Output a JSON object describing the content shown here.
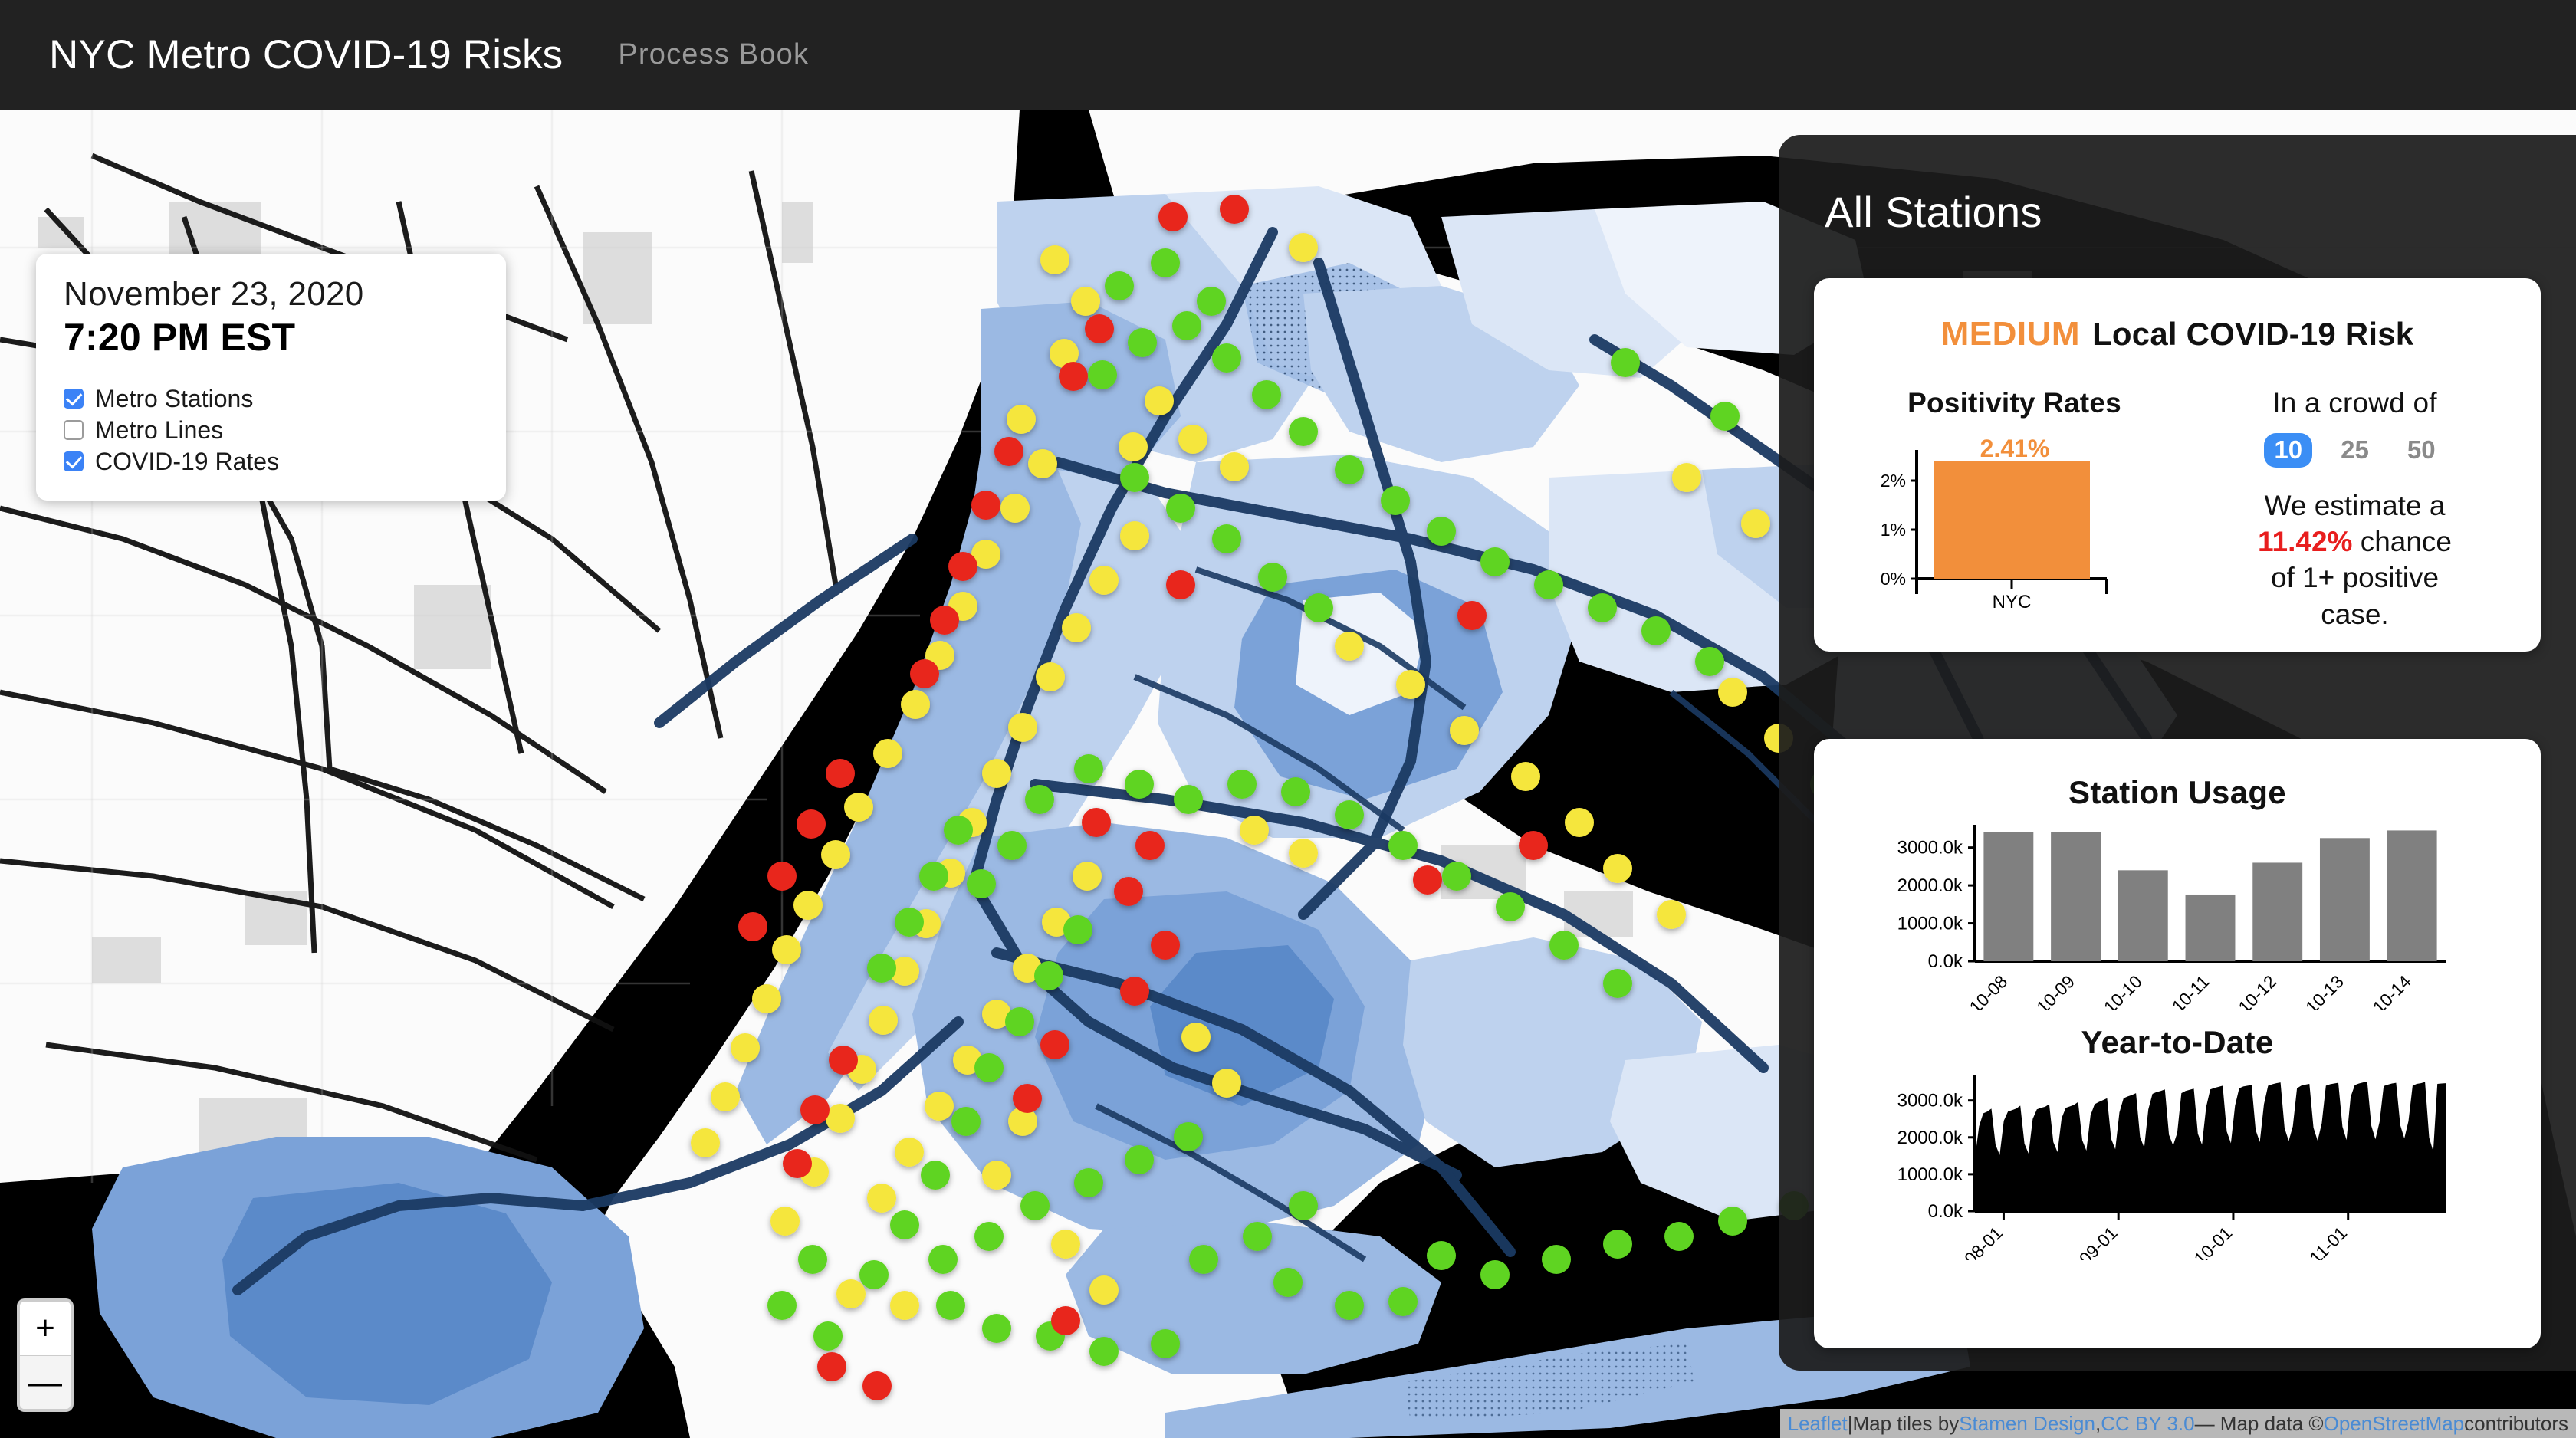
{
  "header": {
    "app_title": "NYC Metro COVID-19 Risks",
    "nav_link": "Process Book"
  },
  "legend": {
    "date": "November 23, 2020",
    "time": "7:20 PM EST",
    "layers": [
      {
        "label": "Metro Stations",
        "checked": true
      },
      {
        "label": "Metro Lines",
        "checked": false
      },
      {
        "label": "COVID-19 Rates",
        "checked": true
      }
    ]
  },
  "map": {
    "zoom_in_label": "+",
    "zoom_out_label": "—",
    "station_colors": {
      "low": "#5ed420",
      "medium": "#f5e63d",
      "high": "#e8251f"
    },
    "choropleth_colors": [
      "#eef3fb",
      "#dbe6f6",
      "#bed2ee",
      "#9bb9e3",
      "#7ba2d8",
      "#5b8ac9"
    ],
    "water_color": "#000000",
    "metro_line_color": "#1b3a63"
  },
  "attribution": {
    "leaflet": "Leaflet",
    "sep1": " | ",
    "tiles_by": "Map tiles by ",
    "stamen": "Stamen Design",
    "comma": ", ",
    "license": "CC BY 3.0",
    "dash": " — Map data © ",
    "osm": "OpenStreetMap",
    "contributors": " contributors"
  },
  "sidebar": {
    "title": "All Stations",
    "risk_card": {
      "risk_level": "MEDIUM",
      "risk_level_color": "#F28F3B",
      "risk_heading": "Local COVID-19 Risk",
      "positivity_heading": "Positivity Rates",
      "crowd_heading": "In a crowd of",
      "crowd_options": [
        {
          "label": "10",
          "active": true
        },
        {
          "label": "25",
          "active": false
        },
        {
          "label": "50",
          "active": false
        }
      ],
      "estimate_prefix": "We estimate a",
      "estimate_value": "11.42%",
      "estimate_value_color": "#E81E1E",
      "estimate_suffix_line1": "chance",
      "estimate_suffix_line2": "of 1+ positive",
      "estimate_suffix_line3": "case."
    }
  },
  "chart_data": [
    {
      "type": "bar",
      "id": "positivity-rates",
      "title": "Positivity Rates",
      "categories": [
        "NYC"
      ],
      "values": [
        2.41
      ],
      "value_labels": [
        "2.41%"
      ],
      "ytick_labels": [
        "0%",
        "1%",
        "2%"
      ],
      "yticks": [
        0,
        1,
        2
      ],
      "ylim": [
        0,
        2.6
      ],
      "xlabel": "",
      "ylabel": "",
      "bar_color": "#F28F3B",
      "grid": false,
      "legend": "none"
    },
    {
      "type": "bar",
      "id": "station-usage",
      "title": "Station Usage",
      "categories": [
        "10-08",
        "10-09",
        "10-10",
        "10-11",
        "10-12",
        "10-13",
        "10-14"
      ],
      "values": [
        3400,
        3410,
        2400,
        1760,
        2600,
        3250,
        3450
      ],
      "ytick_labels": [
        "0.0k",
        "1000.0k",
        "2000.0k",
        "3000.0k"
      ],
      "yticks": [
        0,
        1000,
        2000,
        3000
      ],
      "ylim": [
        0,
        3600
      ],
      "xlabel": "",
      "ylabel": "",
      "bar_color": "#808080",
      "grid": false,
      "legend": "none"
    },
    {
      "type": "area",
      "id": "year-to-date",
      "title": "Year-to-Date",
      "xtick_labels": [
        "08-01",
        "09-01",
        "10-01",
        "11-01"
      ],
      "ytick_labels": [
        "0.0k",
        "1000.0k",
        "2000.0k",
        "3000.0k"
      ],
      "yticks": [
        0,
        1000,
        2000,
        3000
      ],
      "ylim": [
        0,
        3700
      ],
      "xlabel": "",
      "ylabel": "",
      "area_color": "#000000",
      "grid": false,
      "legend": "none",
      "note": "Daily ridership, weekly sawtooth pattern rising from ~2700k weekday peaks in early Aug to ~3500k in mid Nov; weekend troughs ~1500k-2000k.",
      "values": [
        1450,
        2300,
        2650,
        2700,
        2780,
        1800,
        1520,
        2450,
        2700,
        2740,
        2780,
        2860,
        1830,
        1560,
        2500,
        2760,
        2800,
        2830,
        2900,
        1870,
        1600,
        2520,
        2800,
        2840,
        2880,
        2960,
        1920,
        1640,
        2600,
        2900,
        2960,
        3010,
        3060,
        1960,
        1680,
        2680,
        3060,
        3110,
        3150,
        3200,
        2010,
        1720,
        2760,
        3180,
        3230,
        3260,
        3300,
        2070,
        1780,
        2120,
        3200,
        3260,
        3290,
        3320,
        2100,
        1800,
        2820,
        3300,
        3340,
        3370,
        3400,
        2160,
        1840,
        2860,
        3330,
        3380,
        3400,
        3420,
        2200,
        1870,
        2900,
        3400,
        3440,
        3470,
        3490,
        2250,
        1900,
        2300,
        3330,
        3400,
        3430,
        3450,
        2260,
        1910,
        2380,
        3400,
        3440,
        3460,
        3480,
        2290,
        1930,
        3100,
        3420,
        3460,
        3490,
        3510,
        2310,
        1950,
        2420,
        3390,
        3430,
        3460,
        3480,
        2330,
        1970,
        2440,
        3400,
        3450,
        3470,
        3500,
        1990,
        1620,
        3450,
        3460,
        3470
      ]
    }
  ]
}
